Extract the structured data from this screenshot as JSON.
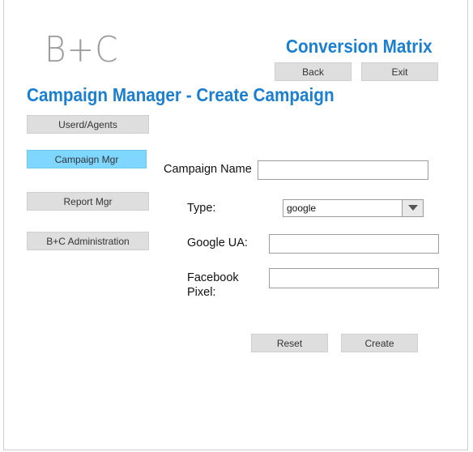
{
  "header": {
    "logo_text": "B+C",
    "app_title": "Conversion Matrix",
    "back_label": "Back",
    "exit_label": "Exit"
  },
  "page_title": "Campaign Manager - Create Campaign",
  "sidebar": {
    "items": [
      {
        "label": "Userd/Agents",
        "active": false
      },
      {
        "label": "Campaign Mgr",
        "active": true
      },
      {
        "label": "Report Mgr",
        "active": false
      },
      {
        "label": "B+C  Administration",
        "active": false
      }
    ]
  },
  "form": {
    "campaign_name_label": "Campaign Name",
    "campaign_name_value": "",
    "type_label": "Type:",
    "type_value": "google",
    "google_ua_label": "Google UA:",
    "google_ua_value": "",
    "facebook_label_line1": "Facebook",
    "facebook_label_line2": "Pixel:",
    "facebook_value": "",
    "reset_label": "Reset",
    "create_label": "Create"
  },
  "colors": {
    "accent": "#1a7fd0",
    "active_nav": "#7fd6ff",
    "button_bg": "#dedede"
  }
}
